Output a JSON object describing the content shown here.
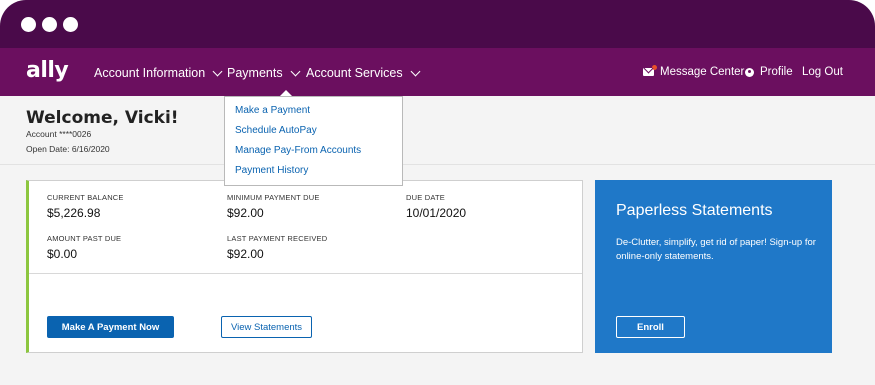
{
  "nav": {
    "logo": "ally",
    "items": [
      {
        "label": "Account Information"
      },
      {
        "label": "Payments"
      },
      {
        "label": "Account Services"
      }
    ],
    "message_center": "Message Center",
    "profile": "Profile",
    "logout": "Log Out"
  },
  "welcome": {
    "title": "Welcome, Vicki!",
    "account": "Account ****0026",
    "open_date": "Open Date: 6/16/2020"
  },
  "payments_menu": {
    "items": [
      {
        "label": "Make a Payment"
      },
      {
        "label": "Schedule AutoPay"
      },
      {
        "label": "Manage Pay-From Accounts"
      },
      {
        "label": "Payment History"
      }
    ]
  },
  "summary": {
    "current_balance_label": "CURRENT BALANCE",
    "current_balance": "$5,226.98",
    "minimum_payment_label": "MINIMUM PAYMENT DUE",
    "minimum_payment": "$92.00",
    "due_date_label": "DUE DATE",
    "due_date": "10/01/2020",
    "amount_past_due_label": "AMOUNT PAST DUE",
    "amount_past_due": "$0.00",
    "last_payment_label": "LAST PAYMENT RECEIVED",
    "last_payment": "$92.00",
    "make_payment_button": "Make A Payment Now",
    "view_statements_button": "View Statements"
  },
  "promo": {
    "title": "Paperless Statements",
    "body": "De-Clutter, simplify, get rid of paper! Sign-up for online-only statements.",
    "button": "Enroll"
  },
  "colors": {
    "frame": "#4a0a4a",
    "nav": "#6b0f5f",
    "accent_blue": "#0a63b0",
    "promo_blue": "#1f78c8",
    "accent_green": "#8cc63f"
  }
}
